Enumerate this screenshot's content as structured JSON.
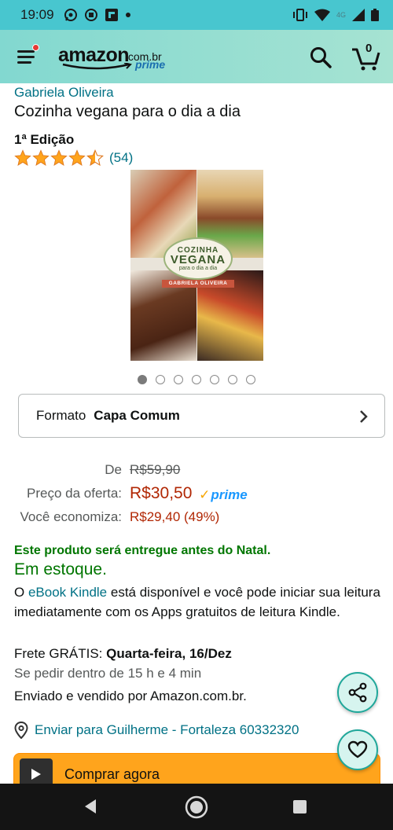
{
  "status_bar": {
    "time": "19:09",
    "network": "4G"
  },
  "header": {
    "logo_word": "amazon",
    "logo_domain": ".com.br",
    "logo_prime": "prime",
    "cart_count": "0"
  },
  "product": {
    "author": "Gabriela Oliveira",
    "title": "Cozinha vegana para o dia a dia",
    "edition": "1ª Edição",
    "rating_stars": 4.5,
    "review_count": "(54)",
    "cover": {
      "line1": "COZINHA",
      "line2": "VEGANA",
      "line3": "para o dia a dia",
      "author": "GABRIELA OLIVEIRA"
    },
    "image_count": 7,
    "active_image": 0
  },
  "format": {
    "label": "Formato",
    "value": "Capa Comum"
  },
  "pricing": {
    "list_label": "De",
    "list_price": "R$59,90",
    "offer_label": "Preço da oferta:",
    "offer_price": "R$30,50",
    "prime_label": "prime",
    "savings_label": "Você economiza:",
    "savings_value": "R$29,40 (49%)"
  },
  "availability": {
    "christmas_note": "Este produto será entregue antes do Natal.",
    "stock": "Em estoque.",
    "kindle_prefix": "O ",
    "kindle_link": "eBook Kindle",
    "kindle_suffix": " está disponível e você pode iniciar sua leitura imediatamente com os Apps gratuitos de leitura Kindle."
  },
  "shipping": {
    "frete_prefix": "Frete GRÁTIS: ",
    "frete_date": "Quarta-feira, 16/Dez",
    "deadline": "Se pedir dentro de 15 h e 4 min",
    "seller": "Enviado e vendido por Amazon.com.br.",
    "deliver_to": "Enviar para Guilherme - Fortaleza 60332320"
  },
  "buy_now": {
    "label": "Comprar agora"
  },
  "colors": {
    "status_bar": "#48c6cf",
    "header_start": "#82d8d0",
    "header_end": "#a6e3d2",
    "link": "#007185",
    "price_red": "#b12704",
    "stock_green": "#007600",
    "buy_button": "#ffa41c",
    "fab_bg": "#d6f4ef",
    "fab_border": "#1fa79a",
    "nav_bar": "#141414"
  }
}
